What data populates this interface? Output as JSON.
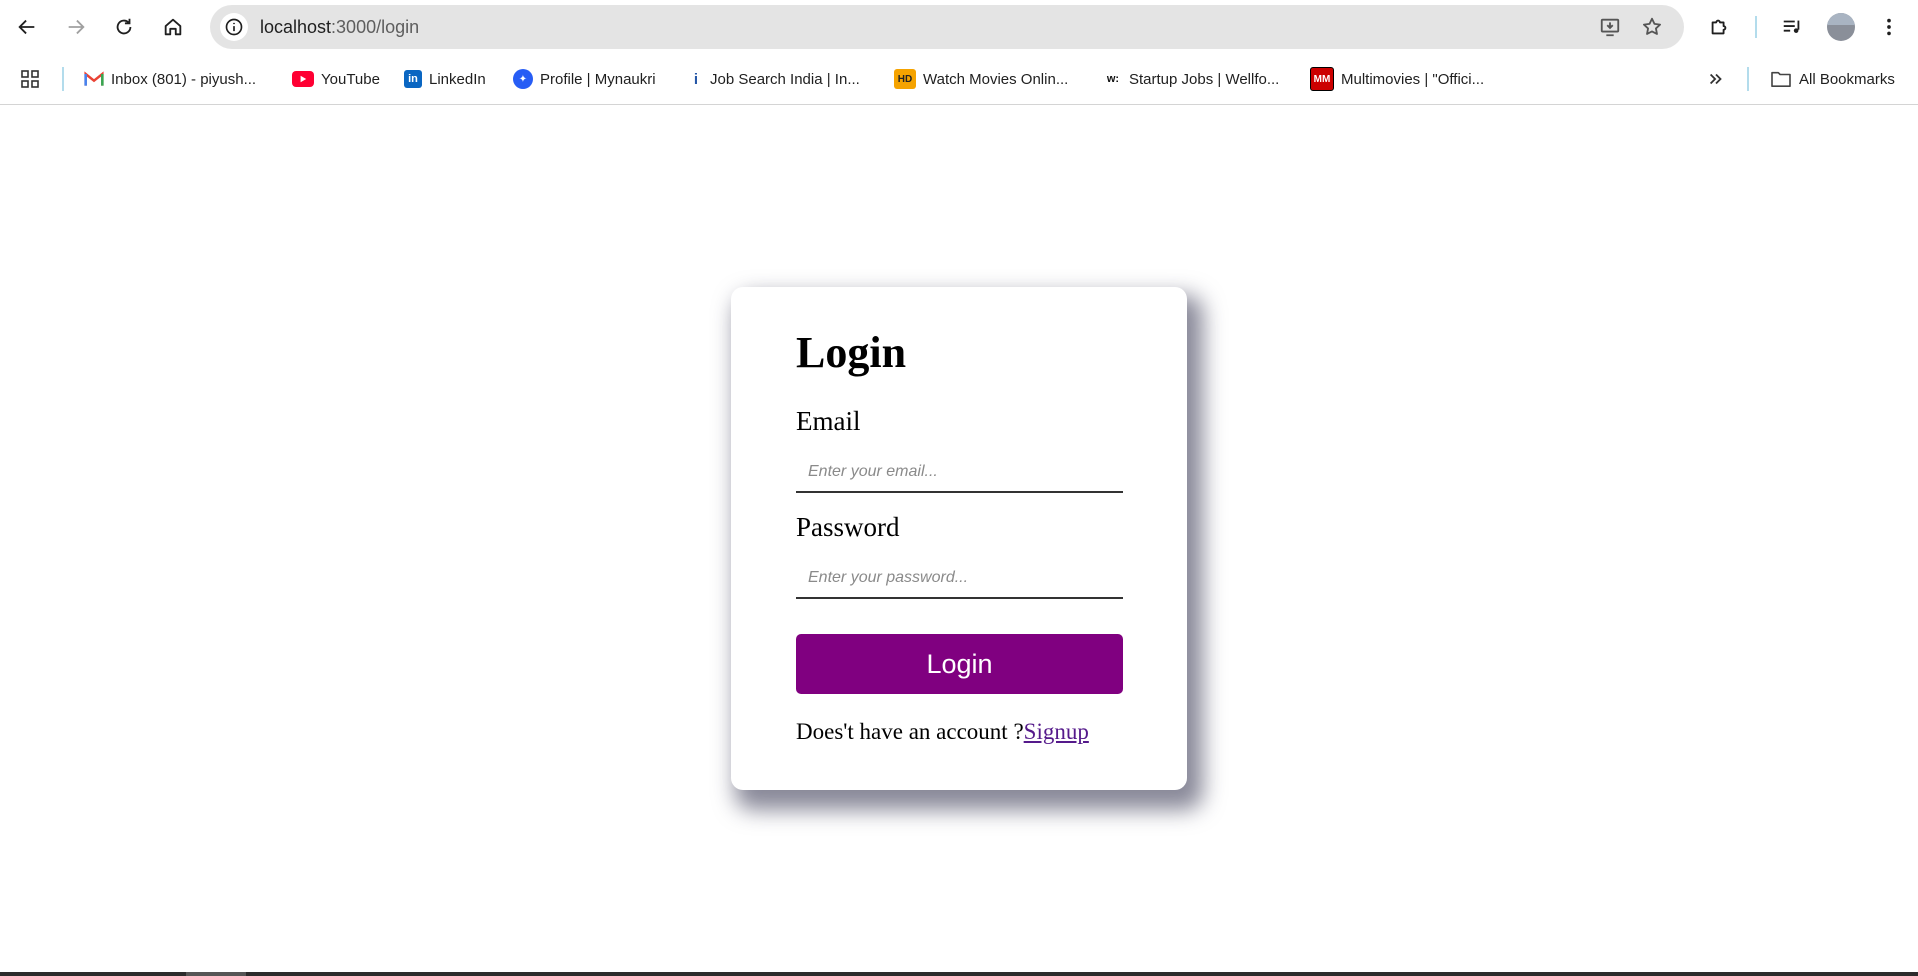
{
  "browser": {
    "url_host": "localhost",
    "url_path": ":3000/login",
    "bookmarks": [
      {
        "label": "Inbox (801) - piyush...",
        "icon": "gmail-icon"
      },
      {
        "label": "YouTube",
        "icon": "youtube-icon"
      },
      {
        "label": "LinkedIn",
        "icon": "linkedin-icon"
      },
      {
        "label": "Profile | Mynaukri",
        "icon": "naukri-icon"
      },
      {
        "label": "Job Search India | In...",
        "icon": "indeed-icon"
      },
      {
        "label": "Watch Movies Onlin...",
        "icon": "hd-icon"
      },
      {
        "label": "Startup Jobs | Wellfo...",
        "icon": "wellfound-icon"
      },
      {
        "label": "Multimovies | \"Offici...",
        "icon": "multimovies-icon"
      }
    ],
    "all_bookmarks_label": "All Bookmarks",
    "colors": {
      "toolbar_bg": "#ffffff",
      "omnibox_bg": "#e4e4e4"
    }
  },
  "login": {
    "title": "Login",
    "email_label": "Email",
    "email_placeholder": "Enter your email...",
    "email_value": "",
    "password_label": "Password",
    "password_placeholder": "Enter your password...",
    "password_value": "",
    "button_label": "Login",
    "signup_prompt": "Does't have an account ?",
    "signup_link": "Signup",
    "colors": {
      "button": "#800080",
      "link": "#551a8b"
    }
  }
}
